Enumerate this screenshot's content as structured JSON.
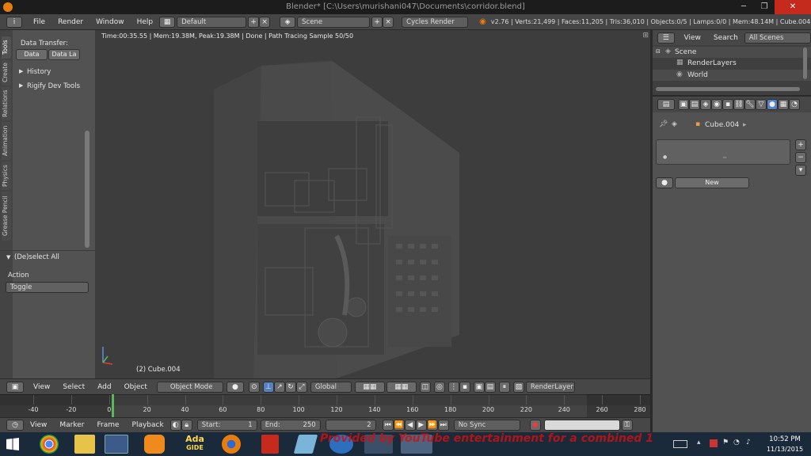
{
  "window": {
    "title": "Blender* [C:\\Users\\murishani047\\Documents\\corridor.blend]",
    "min": "─",
    "max": "❐",
    "close": "✕"
  },
  "info": {
    "menus": [
      "File",
      "Render",
      "Window",
      "Help"
    ],
    "layout": "Default",
    "scene": "Scene",
    "engine": "Cycles Render",
    "stats": "v2.76 | Verts:21,499 | Faces:11,205 | Tris:36,010 | Objects:0/5 | Lamps:0/0 | Mem:48.14M | Cube.004"
  },
  "tools": {
    "tabs": [
      "Tools",
      "Create",
      "Relations",
      "Animation",
      "Physics",
      "Grease Pencil"
    ],
    "data_transfer": "Data Transfer:",
    "data_btn": "Data",
    "data_la_btn": "Data La",
    "history": "History",
    "rigify": "Rigify Dev Tools",
    "deselect_all": "(De)select All",
    "action_label": "Action",
    "action_value": "Toggle"
  },
  "viewport": {
    "status": "Time:00:35.55 | Mem:19.38M, Peak:19.38M | Done | Path Tracing Sample 50/50",
    "object_label": "(2) Cube.004"
  },
  "viewport_header": {
    "view": "View",
    "select": "Select",
    "add": "Add",
    "object": "Object",
    "mode": "Object Mode",
    "orientation": "Global",
    "render_layer": "RenderLayer"
  },
  "timeline": {
    "ticks": [
      "-40",
      "-20",
      "0",
      "20",
      "40",
      "60",
      "80",
      "100",
      "120",
      "140",
      "160",
      "180",
      "200",
      "220",
      "240",
      "260",
      "280"
    ],
    "current_frame": 2,
    "view": "View",
    "marker": "Marker",
    "frame": "Frame",
    "playback": "Playback",
    "start_label": "Start:",
    "start": "1",
    "end_label": "End:",
    "end": "250",
    "frame_value": "2",
    "sync": "No Sync"
  },
  "outliner": {
    "view": "View",
    "search": "Search",
    "filter": "All Scenes",
    "items": [
      "Scene",
      "RenderLayers",
      "World"
    ]
  },
  "properties": {
    "breadcrumb": "Cube.004",
    "new_btn": "New"
  },
  "taskbar": {
    "time": "10:52 PM",
    "date": "11/13/2015",
    "ada_label": "Ada",
    "ada_sub": "GIDE",
    "watermark": "Provided by YouTube entertainment for a combined 13 ye"
  },
  "colors": {
    "accent": "#5680c2",
    "blender_orange": "#e87d0d",
    "close_red": "#c42b1c",
    "frame_green": "#5cb85c"
  }
}
